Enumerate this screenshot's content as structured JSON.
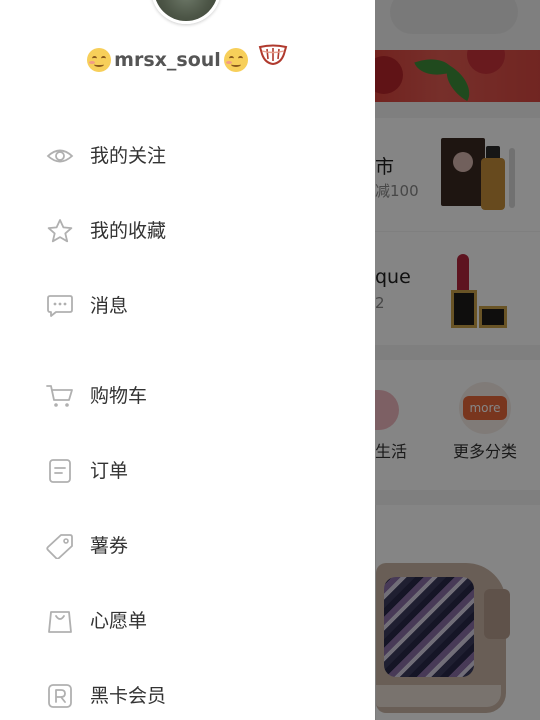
{
  "user": {
    "username": "mrsx_soul"
  },
  "menu_groups": [
    {
      "items": [
        {
          "label": "我的关注",
          "icon": "eye-icon"
        },
        {
          "label": "我的收藏",
          "icon": "star-icon"
        },
        {
          "label": "消息",
          "icon": "message-icon"
        }
      ]
    },
    {
      "items": [
        {
          "label": "购物车",
          "icon": "cart-icon"
        },
        {
          "label": "订单",
          "icon": "order-icon"
        },
        {
          "label": "薯券",
          "icon": "coupon-icon"
        },
        {
          "label": "心愿单",
          "icon": "wishlist-bag-icon"
        },
        {
          "label": "黑卡会员",
          "icon": "registered-card-icon"
        }
      ]
    }
  ],
  "background": {
    "card1": {
      "title": "市",
      "subtitle": "减100"
    },
    "card2": {
      "title": "que",
      "subtitle": "2"
    },
    "categories": [
      {
        "label": "生活"
      },
      {
        "label": "更多分类",
        "badge": "more"
      }
    ]
  },
  "colors": {
    "icon_gray": "#b0b0b0",
    "text_dark": "#333333",
    "more_orange": "#e9683b"
  }
}
